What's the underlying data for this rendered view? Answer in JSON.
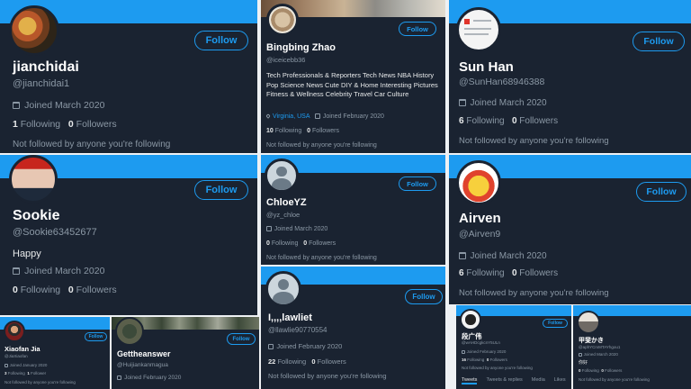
{
  "cards": {
    "jianchidai": {
      "name": "jianchidai",
      "handle": "@jianchidai1",
      "joined": "Joined March 2020",
      "following": "1",
      "following_label": "Following",
      "followers": "0",
      "followers_label": "Followers",
      "footer": "Not followed by anyone you're following",
      "follow": "Follow"
    },
    "bingbing": {
      "name": "Bingbing Zhao",
      "handle": "@iceicebb36",
      "bio": "Tech Professionals & Reporters Tech News NBA History Pop Science News Cute DIY & Home Interesting Pictures Fitness & Wellness Celebrity Travel Car Culture",
      "location": "Virginia, USA",
      "joined": "Joined February 2020",
      "following": "10",
      "following_label": "Following",
      "followers": "0",
      "followers_label": "Followers",
      "footer": "Not followed by anyone you're following",
      "follow": "Follow"
    },
    "sunhan": {
      "name": "Sun Han",
      "handle": "@SunHan68946388",
      "joined": "Joined March 2020",
      "following": "6",
      "following_label": "Following",
      "followers": "0",
      "followers_label": "Followers",
      "footer": "Not followed by anyone you're following",
      "follow": "Follow"
    },
    "sookie": {
      "name": "Sookie",
      "handle": "@Sookie63452677",
      "bio": "Happy",
      "joined": "Joined March 2020",
      "following": "0",
      "following_label": "Following",
      "followers": "0",
      "followers_label": "Followers",
      "follow": "Follow"
    },
    "chloe": {
      "name": "ChloeYZ",
      "handle": "@yz_chloe",
      "joined": "Joined March 2020",
      "following": "0",
      "following_label": "Following",
      "followers": "0",
      "followers_label": "Followers",
      "footer": "Not followed by anyone you're following",
      "follow": "Follow"
    },
    "airven": {
      "name": "Airven",
      "handle": "@Airven9",
      "joined": "Joined March 2020",
      "following": "6",
      "following_label": "Following",
      "followers": "0",
      "followers_label": "Followers",
      "footer": "Not followed by anyone you're following",
      "follow": "Follow"
    },
    "lawliet": {
      "name": "I,,,,lawliet",
      "handle": "@llawlie90770554",
      "joined": "Joined February 2020",
      "following": "22",
      "following_label": "Following",
      "followers": "0",
      "followers_label": "Followers",
      "footer": "Not followed by anyone you're following",
      "follow": "Follow"
    },
    "xiaofan": {
      "name": "Xiaofan Jia",
      "handle": "@JiaXiaofan",
      "joined": "Joined January 2020",
      "following": "3",
      "following_label": "Following",
      "followers": "1",
      "followers_label": "Follower",
      "footer": "Not followed by anyone you're following",
      "follow": "Follow"
    },
    "gett": {
      "name": "Gettheanswer",
      "handle": "@Huijiankanmagua",
      "joined": "Joined February 2020",
      "follow": "Follow"
    },
    "duan": {
      "name": "段广伟",
      "handle": "@wAHDcgkcnY5ULn",
      "joined": "Joined February 2020",
      "following": "16",
      "following_label": "Following",
      "followers": "0",
      "followers_label": "Followers",
      "footer": "Not followed by anyone you're following",
      "follow": "Follow",
      "tabs": [
        "Tweets",
        "Tweets & replies",
        "Media",
        "Likes"
      ]
    },
    "kaki": {
      "name": "甲斐かき",
      "handle": "@aphYCrxMTAYhgou1",
      "joined": "Joined March 2020",
      "bio": "你好",
      "following": "0",
      "following_label": "Following",
      "followers": "0",
      "followers_label": "Followers",
      "footer": "Not followed by anyone you're following"
    }
  },
  "colors": {
    "accent": "#1d9bf0",
    "card_bg": "#1a2331",
    "muted": "#8b98a5",
    "text": "#e7e9ea"
  },
  "icons": {
    "calendar": "calendar-icon",
    "location": "location-pin-icon",
    "default_avatar": "default-profile-icon"
  }
}
